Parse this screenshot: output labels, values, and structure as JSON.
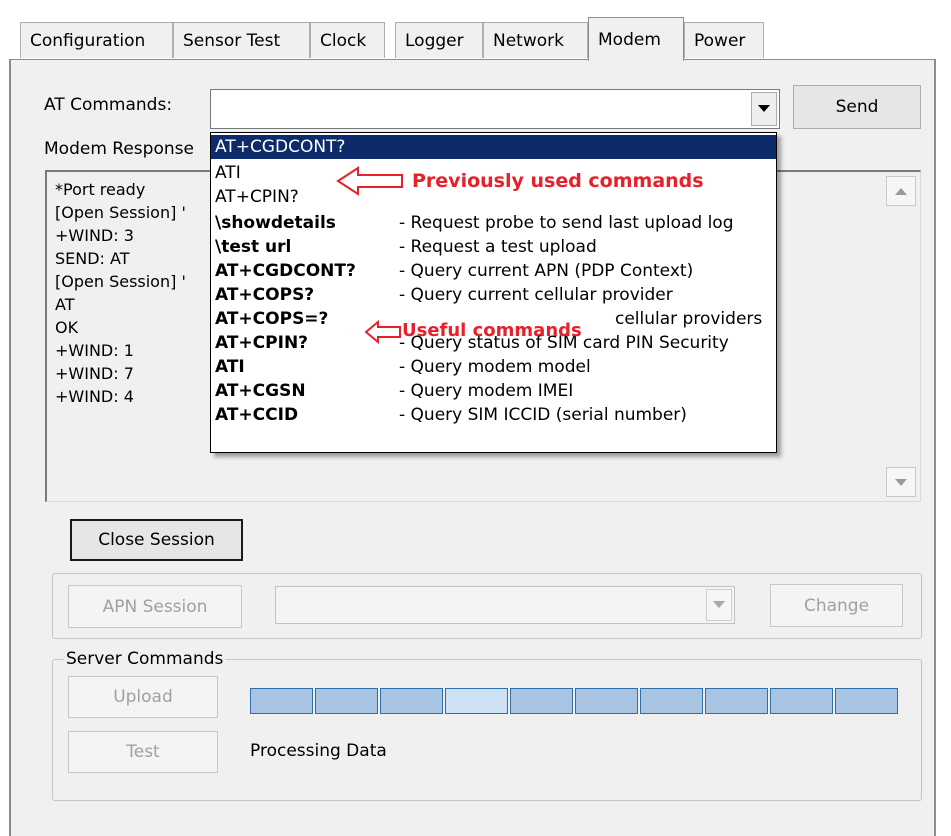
{
  "tabs": [
    {
      "label": "Configuration"
    },
    {
      "label": "Sensor Test"
    },
    {
      "label": "Clock"
    },
    {
      "label": "Logger"
    },
    {
      "label": "Network"
    },
    {
      "label": "Modem"
    },
    {
      "label": "Power"
    }
  ],
  "at_commands": {
    "label": "AT Commands:",
    "value": "",
    "send_button": "Send"
  },
  "modem_response": {
    "label": "Modem Response",
    "lines": [
      "*Port ready",
      "[Open Session] '",
      "+WIND: 3",
      "SEND: AT",
      "[Open Session] '",
      "AT",
      "OK",
      "+WIND: 1",
      "+WIND: 7",
      "+WIND: 4"
    ]
  },
  "close_session_button": "Close Session",
  "apn": {
    "button": "APN Session",
    "value": "",
    "change_button": "Change"
  },
  "server_commands": {
    "title": "Server Commands",
    "upload_button": "Upload",
    "test_button": "Test",
    "status": "Processing Data",
    "progress_segments": 10,
    "highlighted_segment": 4
  },
  "dropdown": {
    "history": [
      {
        "cmd": "AT+CGDCONT?",
        "selected": true
      },
      {
        "cmd": "ATI",
        "selected": false
      },
      {
        "cmd": "AT+CPIN?",
        "selected": false
      }
    ],
    "useful": [
      {
        "cmd": "\\showdetails",
        "desc": "- Request probe to send last upload log"
      },
      {
        "cmd": "\\test url",
        "desc": "- Request a test upload"
      },
      {
        "cmd": "AT+CGDCONT?",
        "desc": "- Query current APN (PDP Context)"
      },
      {
        "cmd": "AT+COPS?",
        "desc": "- Query current cellular provider"
      },
      {
        "cmd": "AT+COPS=?",
        "desc": "cellular providers"
      },
      {
        "cmd": "AT+CPIN?",
        "desc": "- Query status of SIM card PIN Security"
      },
      {
        "cmd": "ATI",
        "desc": "- Query modem model"
      },
      {
        "cmd": "AT+CGSN",
        "desc": "- Query modem IMEI"
      },
      {
        "cmd": "AT+CCID",
        "desc": "- Query SIM ICCID (serial number)"
      }
    ]
  },
  "annotations": {
    "previous": "Previously used commands",
    "useful": "Useful commands"
  },
  "colors": {
    "annotation": "#e8202a",
    "selection": "#0d2a6b",
    "progress_fill": "#a8c4e2",
    "progress_highlight": "#cfe2f5",
    "progress_border": "#2f6fab"
  }
}
